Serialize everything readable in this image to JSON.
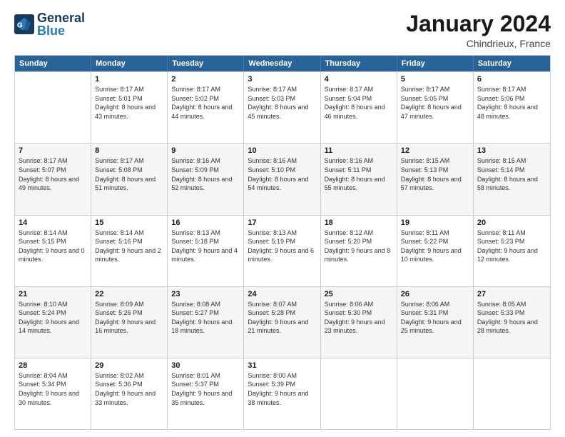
{
  "logo": {
    "text_general": "General",
    "text_blue": "Blue"
  },
  "header": {
    "month": "January 2024",
    "location": "Chindrieux, France"
  },
  "days": [
    "Sunday",
    "Monday",
    "Tuesday",
    "Wednesday",
    "Thursday",
    "Friday",
    "Saturday"
  ],
  "weeks": [
    [
      {
        "day": "",
        "sunrise": "",
        "sunset": "",
        "daylight": ""
      },
      {
        "day": "1",
        "sunrise": "Sunrise: 8:17 AM",
        "sunset": "Sunset: 5:01 PM",
        "daylight": "Daylight: 8 hours and 43 minutes."
      },
      {
        "day": "2",
        "sunrise": "Sunrise: 8:17 AM",
        "sunset": "Sunset: 5:02 PM",
        "daylight": "Daylight: 8 hours and 44 minutes."
      },
      {
        "day": "3",
        "sunrise": "Sunrise: 8:17 AM",
        "sunset": "Sunset: 5:03 PM",
        "daylight": "Daylight: 8 hours and 45 minutes."
      },
      {
        "day": "4",
        "sunrise": "Sunrise: 8:17 AM",
        "sunset": "Sunset: 5:04 PM",
        "daylight": "Daylight: 8 hours and 46 minutes."
      },
      {
        "day": "5",
        "sunrise": "Sunrise: 8:17 AM",
        "sunset": "Sunset: 5:05 PM",
        "daylight": "Daylight: 8 hours and 47 minutes."
      },
      {
        "day": "6",
        "sunrise": "Sunrise: 8:17 AM",
        "sunset": "Sunset: 5:06 PM",
        "daylight": "Daylight: 8 hours and 48 minutes."
      }
    ],
    [
      {
        "day": "7",
        "sunrise": "Sunrise: 8:17 AM",
        "sunset": "Sunset: 5:07 PM",
        "daylight": "Daylight: 8 hours and 49 minutes."
      },
      {
        "day": "8",
        "sunrise": "Sunrise: 8:17 AM",
        "sunset": "Sunset: 5:08 PM",
        "daylight": "Daylight: 8 hours and 51 minutes."
      },
      {
        "day": "9",
        "sunrise": "Sunrise: 8:16 AM",
        "sunset": "Sunset: 5:09 PM",
        "daylight": "Daylight: 8 hours and 52 minutes."
      },
      {
        "day": "10",
        "sunrise": "Sunrise: 8:16 AM",
        "sunset": "Sunset: 5:10 PM",
        "daylight": "Daylight: 8 hours and 54 minutes."
      },
      {
        "day": "11",
        "sunrise": "Sunrise: 8:16 AM",
        "sunset": "Sunset: 5:11 PM",
        "daylight": "Daylight: 8 hours and 55 minutes."
      },
      {
        "day": "12",
        "sunrise": "Sunrise: 8:15 AM",
        "sunset": "Sunset: 5:13 PM",
        "daylight": "Daylight: 8 hours and 57 minutes."
      },
      {
        "day": "13",
        "sunrise": "Sunrise: 8:15 AM",
        "sunset": "Sunset: 5:14 PM",
        "daylight": "Daylight: 8 hours and 58 minutes."
      }
    ],
    [
      {
        "day": "14",
        "sunrise": "Sunrise: 8:14 AM",
        "sunset": "Sunset: 5:15 PM",
        "daylight": "Daylight: 9 hours and 0 minutes."
      },
      {
        "day": "15",
        "sunrise": "Sunrise: 8:14 AM",
        "sunset": "Sunset: 5:16 PM",
        "daylight": "Daylight: 9 hours and 2 minutes."
      },
      {
        "day": "16",
        "sunrise": "Sunrise: 8:13 AM",
        "sunset": "Sunset: 5:18 PM",
        "daylight": "Daylight: 9 hours and 4 minutes."
      },
      {
        "day": "17",
        "sunrise": "Sunrise: 8:13 AM",
        "sunset": "Sunset: 5:19 PM",
        "daylight": "Daylight: 9 hours and 6 minutes."
      },
      {
        "day": "18",
        "sunrise": "Sunrise: 8:12 AM",
        "sunset": "Sunset: 5:20 PM",
        "daylight": "Daylight: 9 hours and 8 minutes."
      },
      {
        "day": "19",
        "sunrise": "Sunrise: 8:11 AM",
        "sunset": "Sunset: 5:22 PM",
        "daylight": "Daylight: 9 hours and 10 minutes."
      },
      {
        "day": "20",
        "sunrise": "Sunrise: 8:11 AM",
        "sunset": "Sunset: 5:23 PM",
        "daylight": "Daylight: 9 hours and 12 minutes."
      }
    ],
    [
      {
        "day": "21",
        "sunrise": "Sunrise: 8:10 AM",
        "sunset": "Sunset: 5:24 PM",
        "daylight": "Daylight: 9 hours and 14 minutes."
      },
      {
        "day": "22",
        "sunrise": "Sunrise: 8:09 AM",
        "sunset": "Sunset: 5:26 PM",
        "daylight": "Daylight: 9 hours and 16 minutes."
      },
      {
        "day": "23",
        "sunrise": "Sunrise: 8:08 AM",
        "sunset": "Sunset: 5:27 PM",
        "daylight": "Daylight: 9 hours and 18 minutes."
      },
      {
        "day": "24",
        "sunrise": "Sunrise: 8:07 AM",
        "sunset": "Sunset: 5:28 PM",
        "daylight": "Daylight: 9 hours and 21 minutes."
      },
      {
        "day": "25",
        "sunrise": "Sunrise: 8:06 AM",
        "sunset": "Sunset: 5:30 PM",
        "daylight": "Daylight: 9 hours and 23 minutes."
      },
      {
        "day": "26",
        "sunrise": "Sunrise: 8:06 AM",
        "sunset": "Sunset: 5:31 PM",
        "daylight": "Daylight: 9 hours and 25 minutes."
      },
      {
        "day": "27",
        "sunrise": "Sunrise: 8:05 AM",
        "sunset": "Sunset: 5:33 PM",
        "daylight": "Daylight: 9 hours and 28 minutes."
      }
    ],
    [
      {
        "day": "28",
        "sunrise": "Sunrise: 8:04 AM",
        "sunset": "Sunset: 5:34 PM",
        "daylight": "Daylight: 9 hours and 30 minutes."
      },
      {
        "day": "29",
        "sunrise": "Sunrise: 8:02 AM",
        "sunset": "Sunset: 5:36 PM",
        "daylight": "Daylight: 9 hours and 33 minutes."
      },
      {
        "day": "30",
        "sunrise": "Sunrise: 8:01 AM",
        "sunset": "Sunset: 5:37 PM",
        "daylight": "Daylight: 9 hours and 35 minutes."
      },
      {
        "day": "31",
        "sunrise": "Sunrise: 8:00 AM",
        "sunset": "Sunset: 5:39 PM",
        "daylight": "Daylight: 9 hours and 38 minutes."
      },
      {
        "day": "",
        "sunrise": "",
        "sunset": "",
        "daylight": ""
      },
      {
        "day": "",
        "sunrise": "",
        "sunset": "",
        "daylight": ""
      },
      {
        "day": "",
        "sunrise": "",
        "sunset": "",
        "daylight": ""
      }
    ]
  ]
}
